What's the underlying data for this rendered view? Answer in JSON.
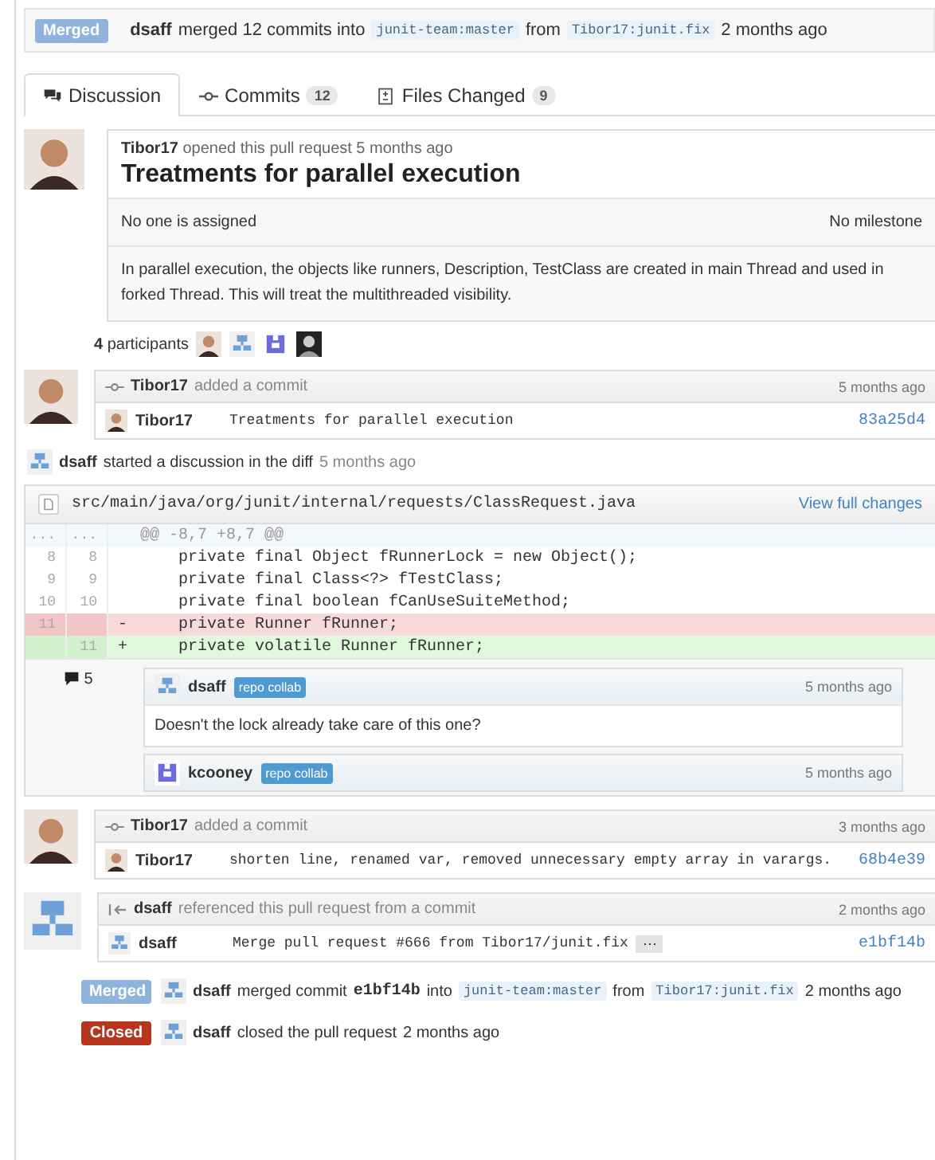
{
  "header": {
    "badge": {
      "kind": "merged",
      "text": "Merged"
    },
    "author": "dsaff",
    "segments": [
      {
        "kind": "text",
        "text": "merged 12 commits into"
      },
      {
        "kind": "ref",
        "text": "junit-team:master"
      },
      {
        "kind": "text",
        "text": "from"
      },
      {
        "kind": "ref",
        "text": "Tibor17:junit.fix"
      },
      {
        "kind": "text",
        "text": "2 months ago"
      }
    ]
  },
  "tabs": [
    {
      "kind": "discussion",
      "label": "Discussion",
      "selected": true
    },
    {
      "kind": "commit",
      "label": "Commits",
      "count": "12",
      "selected": false
    },
    {
      "kind": "file",
      "label": "Files Changed",
      "count": "9",
      "selected": false
    }
  ],
  "pull_request": {
    "avatar": {
      "kind": "photo"
    },
    "author": "Tibor17",
    "meta": "opened this pull request 5 months ago",
    "title": "Treatments for parallel execution",
    "assignee": "No one is assigned",
    "milestone": "No milestone",
    "body": "In parallel execution, the objects like runners, Description, TestClass are created in main Thread and used in forked Thread. This will treat the multithreaded visibility."
  },
  "participants": {
    "count": "4",
    "label": "participants",
    "avatars": [
      {
        "kind": "photo"
      },
      {
        "kind": "tree"
      },
      {
        "kind": "plug"
      },
      {
        "kind": "dark"
      }
    ]
  },
  "timeline": [
    {
      "kind": "commit",
      "avatar": {
        "kind": "photo"
      },
      "author": "Tibor17",
      "action": "added a commit",
      "time": "5 months ago",
      "commits": [
        {
          "avatar": {
            "kind": "photo"
          },
          "author": "Tibor17",
          "message": "Treatments for parallel execution",
          "sha": "83a25d4"
        }
      ]
    },
    {
      "kind": "discussion",
      "avatar": {
        "kind": "tree"
      },
      "author": "dsaff",
      "action": "started a discussion in the diff",
      "time": "5 months ago",
      "file": "src/main/java/org/junit/internal/requests/ClassRequest.java",
      "link": "View full changes",
      "lines": [
        {
          "kind": "hunk",
          "old": "...",
          "new": "...",
          "code": "@@ -8,7 +8,7 @@"
        },
        {
          "kind": "context",
          "old": "8",
          "new": "8",
          "code": "    private final Object fRunnerLock = new Object();"
        },
        {
          "kind": "context",
          "old": "9",
          "new": "9",
          "code": "    private final Class<?> fTestClass;"
        },
        {
          "kind": "context",
          "old": "10",
          "new": "10",
          "code": "    private final boolean fCanUseSuiteMethod;"
        },
        {
          "kind": "deletion",
          "old": "11",
          "sign": "-",
          "code": "    private Runner fRunner;"
        },
        {
          "kind": "addition",
          "new": "11",
          "sign": "+",
          "code": "    private volatile Runner fRunner;"
        }
      ],
      "comment_count": "5",
      "comments": [
        {
          "avatar": {
            "kind": "tree"
          },
          "author": "dsaff",
          "badge": "repo collab",
          "time": "5 months ago",
          "body": "Doesn't the lock already take care of this one?"
        },
        {
          "avatar": {
            "kind": "plug"
          },
          "author": "kcooney",
          "badge": "repo collab",
          "time": "5 months ago"
        }
      ]
    },
    {
      "kind": "commit",
      "avatar": {
        "kind": "photo"
      },
      "author": "Tibor17",
      "action": "added a commit",
      "time": "3 months ago",
      "commits": [
        {
          "avatar": {
            "kind": "photo"
          },
          "author": "Tibor17",
          "message": "shorten line, renamed var, removed unnecessary empty array in varargs.",
          "sha": "68b4e39"
        }
      ]
    },
    {
      "kind": "reference",
      "avatar": {
        "kind": "tree"
      },
      "author": "dsaff",
      "action": "referenced this pull request from a commit",
      "time": "2 months ago",
      "commits": [
        {
          "avatar": {
            "kind": "tree"
          },
          "author": "dsaff",
          "message": "Merge pull request #666 from Tibor17/junit.fix",
          "more": "···",
          "sha": "e1bf14b"
        }
      ]
    },
    {
      "kind": "event",
      "badge": {
        "kind": "merged",
        "text": "Merged"
      },
      "avatar": {
        "kind": "tree"
      },
      "author": "dsaff",
      "segments": [
        {
          "kind": "text",
          "text": "merged commit"
        },
        {
          "kind": "sha",
          "text": "e1bf14b"
        },
        {
          "kind": "text",
          "text": "into"
        },
        {
          "kind": "ref",
          "text": "junit-team:master"
        },
        {
          "kind": "text",
          "text": "from"
        },
        {
          "kind": "ref",
          "text": "Tibor17:junit.fix"
        },
        {
          "kind": "text",
          "text": "2 months ago"
        }
      ]
    },
    {
      "kind": "event",
      "badge": {
        "kind": "closed",
        "text": "Closed"
      },
      "avatar": {
        "kind": "tree"
      },
      "author": "dsaff",
      "segments": [
        {
          "kind": "text",
          "text": "closed the pull request"
        },
        {
          "kind": "text",
          "text": "2 months ago"
        }
      ]
    }
  ]
}
